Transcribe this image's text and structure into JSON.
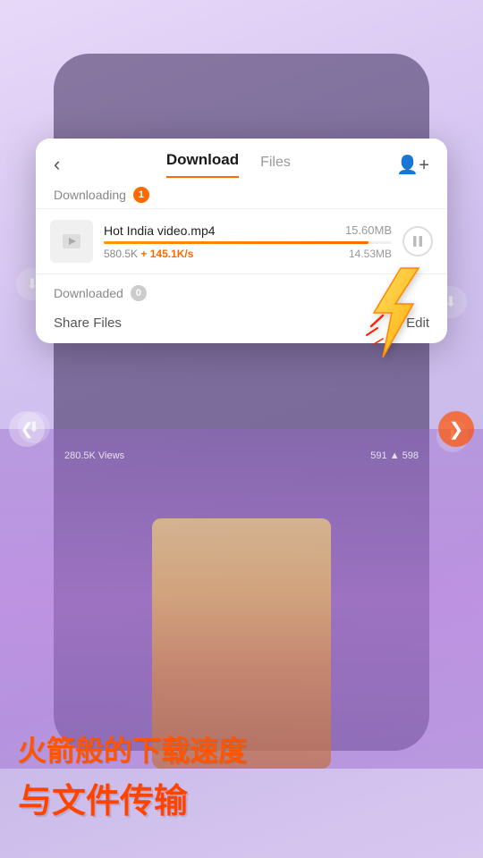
{
  "header": {
    "back_label": "‹",
    "tab_download": "Download",
    "tab_files": "Files",
    "add_user_icon": "person+"
  },
  "downloading": {
    "section_title": "Downloading",
    "badge_count": "1",
    "item": {
      "name": "Hot India video.mp4",
      "size_total": "15.60MB",
      "speed": "580.5K",
      "speed_delta": "+ 145.1K/s",
      "size_done": "14.53MB",
      "progress_pct": 92
    }
  },
  "downloaded": {
    "section_title": "Downloaded",
    "badge_count": "0",
    "share_label": "Share Files",
    "edit_label": "Edit"
  },
  "bottom_text": {
    "line1": "火箭般的下载速度",
    "line2": "与文件传输"
  },
  "colors": {
    "accent": "#ff6a00",
    "text_orange": "#ff5500",
    "text_orange_dark": "#ff4400"
  }
}
